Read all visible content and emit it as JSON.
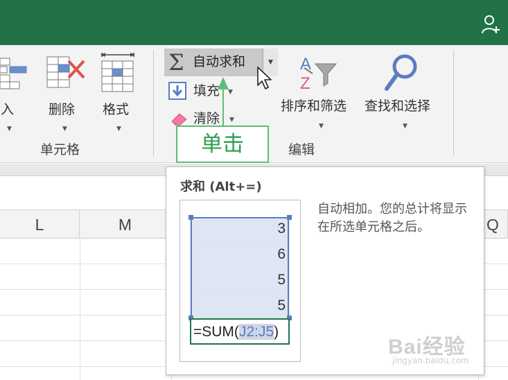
{
  "ribbon": {
    "insert_label": "插入",
    "delete_label": "删除",
    "format_label": "格式",
    "cells_group_label": "单元格",
    "autosum_label": "自动求和",
    "fill_label": "填充",
    "clear_label": "清除",
    "sort_filter_label": "排序和筛选",
    "find_select_label": "查找和选择",
    "editing_group_label": "编辑"
  },
  "callout": {
    "text": "单击"
  },
  "columns": [
    "L",
    "M",
    "Q"
  ],
  "tooltip": {
    "title": "求和 (Alt+=)",
    "description": "自动相加。您的总计将显示在所选单元格之后。",
    "preview_values": [
      "3",
      "6",
      "5",
      "5"
    ],
    "formula_prefix": "=SUM(",
    "formula_ref": "J2:J5",
    "formula_suffix": ")"
  },
  "watermark": {
    "text": "Bai经验",
    "subtext": "jingyan.baidu.com"
  },
  "colors": {
    "title_bar": "#217346",
    "autosum_highlight": "#c9c9c9",
    "callout_border": "#5cbd78",
    "range_border": "#5a7dbf"
  },
  "icons": [
    "user-add-icon",
    "insert-cells-icon",
    "delete-cells-icon",
    "format-cells-icon",
    "autosum-sigma-icon",
    "fill-down-icon",
    "eraser-icon",
    "sort-filter-icon",
    "find-magnifier-icon",
    "mouse-pointer-icon",
    "up-arrow-icon"
  ]
}
